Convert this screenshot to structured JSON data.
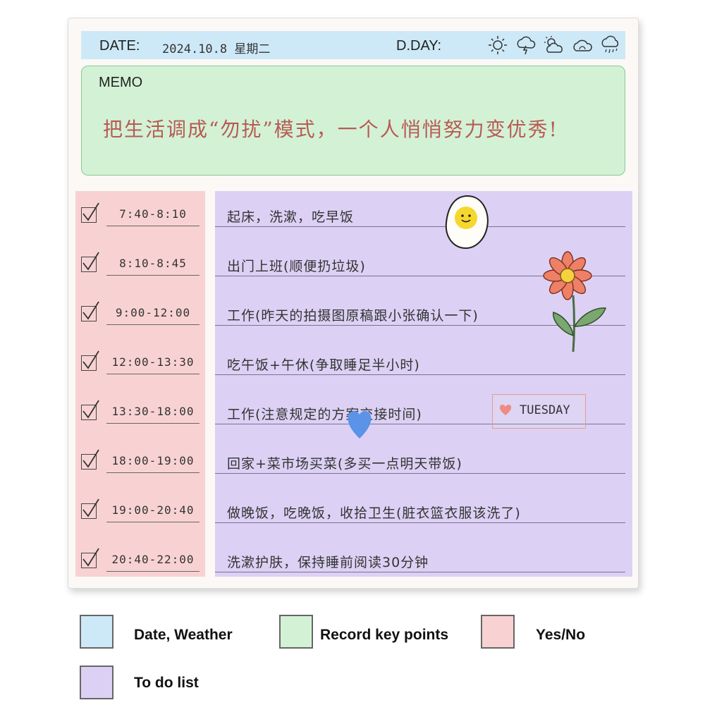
{
  "header": {
    "date_label": "DATE:",
    "date_value": "2024.10.8 星期二",
    "dday_label": "D.DAY:",
    "weather_icons": [
      "sun-icon",
      "thunderstorm-icon",
      "sun-cloud-icon",
      "cloud-icon",
      "rain-icon"
    ]
  },
  "memo": {
    "label": "MEMO",
    "text": "把生活调成“勿扰”模式，一个人悄悄努力变优秀!"
  },
  "schedule": [
    {
      "time": "7:40-8:10",
      "task": "起床，洗漱，吃早饭",
      "done": true
    },
    {
      "time": "8:10-8:45",
      "task": "出门上班(顺便扔垃圾)",
      "done": true
    },
    {
      "time": "9:00-12:00",
      "task": "工作(昨天的拍摄图原稿跟小张确认一下)",
      "done": true
    },
    {
      "time": "12:00-13:30",
      "task": "吃午饭+午休(争取睡足半小时)",
      "done": true
    },
    {
      "time": "13:30-18:00",
      "task": "工作(注意规定的方案交接时间)",
      "done": true
    },
    {
      "time": "18:00-19:00",
      "task": "回家+菜市场买菜(多买一点明天带饭)",
      "done": true
    },
    {
      "time": "19:00-20:40",
      "task": "做晚饭，吃晚饭，收拾卫生(脏衣篮衣服该洗了)",
      "done": true
    },
    {
      "time": "20:40-22:00",
      "task": "洗漱护肤，保持睡前阅读30分钟",
      "done": true
    }
  ],
  "sticker": {
    "tuesday": "TUESDAY"
  },
  "legend": [
    {
      "label": "Date, Weather",
      "color": "#cde9f7"
    },
    {
      "label": "Record key points",
      "color": "#d3f2d5"
    },
    {
      "label": "Yes/No",
      "color": "#f8d2d2"
    },
    {
      "label": "To do list",
      "color": "#dcd1f4"
    }
  ]
}
